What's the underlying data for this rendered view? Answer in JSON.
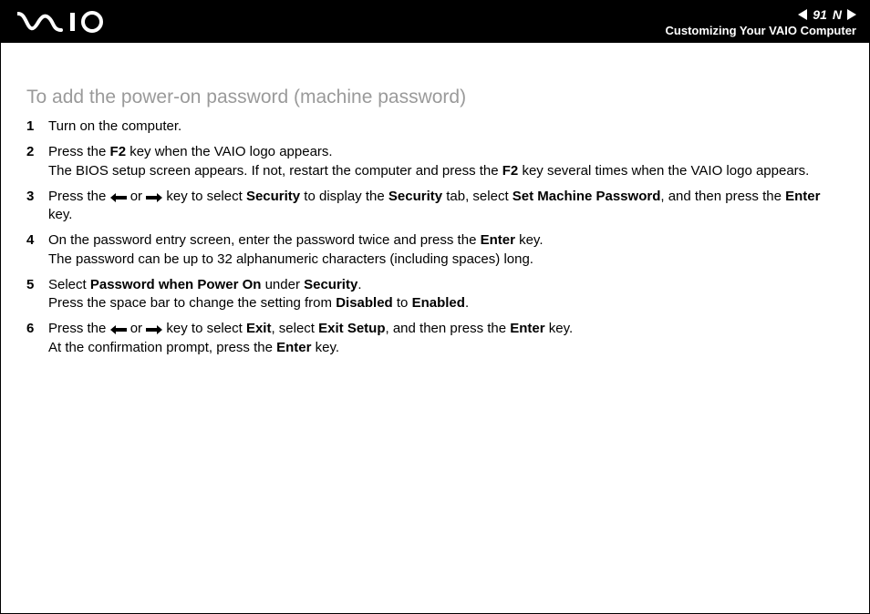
{
  "header": {
    "page_number": "91",
    "n_label": "N",
    "breadcrumb": "Customizing Your VAIO Computer"
  },
  "title": "To add the power-on password (machine password)",
  "steps": {
    "s1": "Turn on the computer.",
    "s2a": "Press the ",
    "s2b": "F2",
    "s2c": " key when the VAIO logo appears.",
    "s2d": "The BIOS setup screen appears. If not, restart the computer and press the ",
    "s2e": "F2",
    "s2f": " key several times when the VAIO logo appears.",
    "s3a": "Press the ",
    "s3b": " or ",
    "s3c": " key to select ",
    "s3d": "Security",
    "s3e": " to display the ",
    "s3f": "Security",
    "s3g": " tab, select ",
    "s3h": "Set Machine Password",
    "s3i": ", and then press the ",
    "s3j": "Enter",
    "s3k": " key.",
    "s4a": "On the password entry screen, enter the password twice and press the ",
    "s4b": "Enter",
    "s4c": " key.",
    "s4d": "The password can be up to 32 alphanumeric characters (including spaces) long.",
    "s5a": "Select ",
    "s5b": "Password when Power On",
    "s5c": " under ",
    "s5d": "Security",
    "s5e": ".",
    "s5f": "Press the space bar to change the setting from ",
    "s5g": "Disabled",
    "s5h": " to ",
    "s5i": "Enabled",
    "s5j": ".",
    "s6a": "Press the ",
    "s6b": " or ",
    "s6c": " key to select ",
    "s6d": "Exit",
    "s6e": ", select ",
    "s6f": "Exit Setup",
    "s6g": ", and then press the ",
    "s6h": "Enter",
    "s6i": " key.",
    "s6j": "At the confirmation prompt, press the ",
    "s6k": "Enter",
    "s6l": " key."
  }
}
